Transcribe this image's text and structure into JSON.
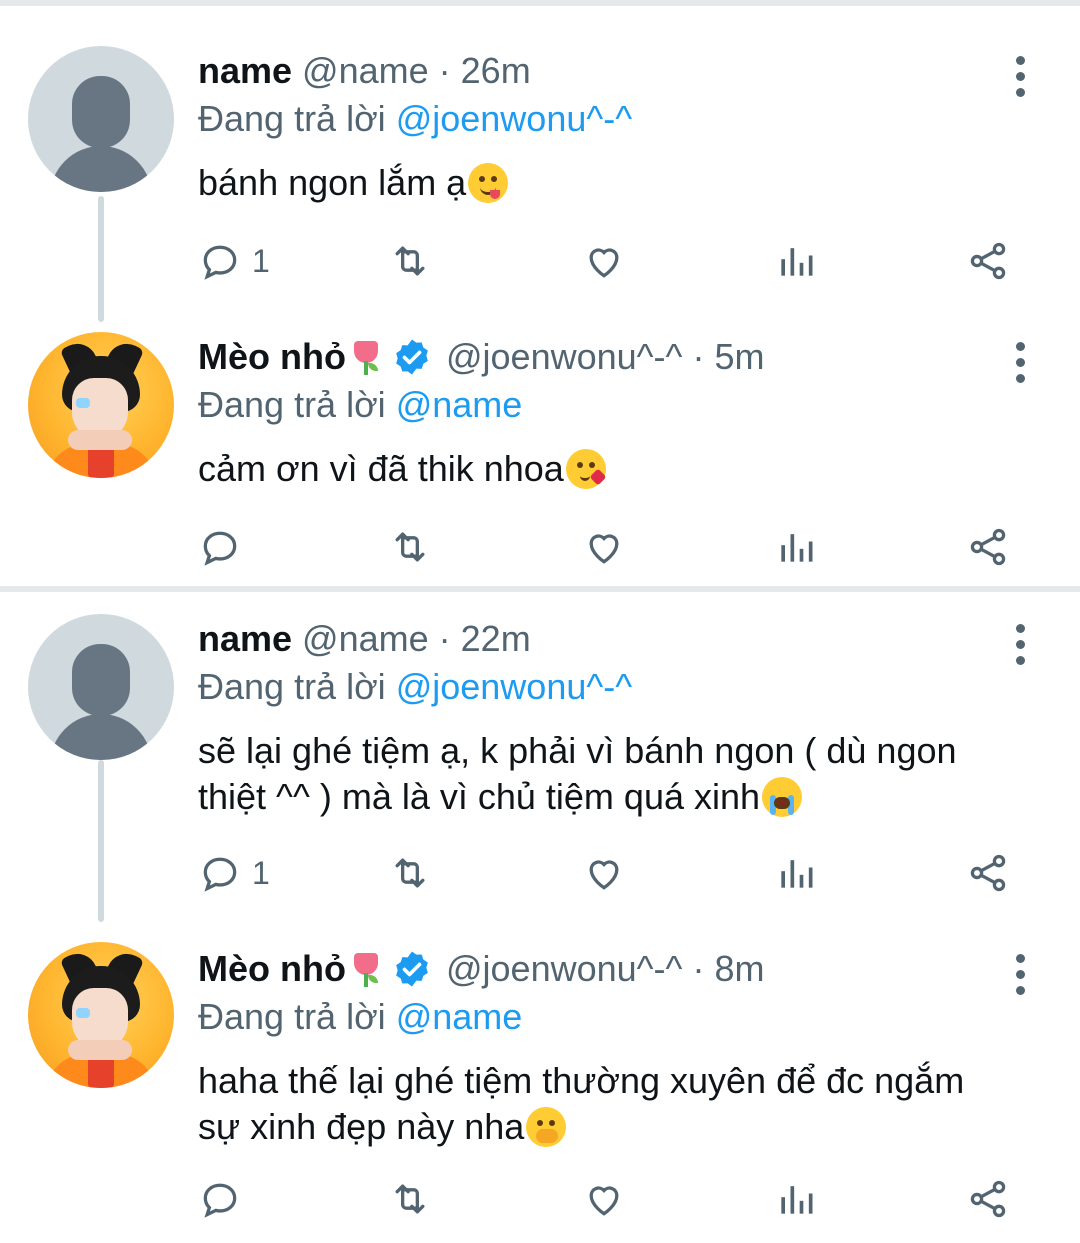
{
  "threads": [
    {
      "tweets": [
        {
          "name": "name",
          "handle": "@name",
          "separator": "·",
          "time": "26m",
          "reply_prefix": "Đang trả lời",
          "reply_to": "@joenwonu^-^",
          "text": "bánh ngon lắm ạ",
          "emoji": "face-savoring-food-emoji",
          "reply_count": "1"
        },
        {
          "name": "Mèo nhỏ",
          "handle": "@joenwonu^-^",
          "separator": "·",
          "time": "5m",
          "reply_prefix": "Đang trả lời",
          "reply_to": "@name",
          "text": "cảm ơn vì đã thik nhoa",
          "emoji": "face-blowing-kiss-emoji",
          "reply_count": ""
        }
      ]
    },
    {
      "tweets": [
        {
          "name": "name",
          "handle": "@name",
          "separator": "·",
          "time": "22m",
          "reply_prefix": "Đang trả lời",
          "reply_to": "@joenwonu^-^",
          "text_line1": "sẽ lại ghé tiệm ạ, k phải vì bánh ngon ( dù ngon",
          "text_line2": "thiệt ^^ ) mà là vì chủ tiệm quá xinh",
          "emoji": "loudly-crying-face-emoji",
          "reply_count": "1"
        },
        {
          "name": "Mèo nhỏ",
          "handle": "@joenwonu^-^",
          "separator": "·",
          "time": "8m",
          "reply_prefix": "Đang trả lời",
          "reply_to": "@name",
          "text_line1": "haha thế lại ghé tiệm thường xuyên để đc ngắm",
          "text_line2": "sự xinh đẹp này nha",
          "emoji": "face-with-hand-over-mouth-emoji",
          "reply_count": ""
        }
      ]
    }
  ],
  "colors": {
    "text": "#0f1419",
    "secondary": "#536471",
    "link": "#1d9bf0",
    "divider": "#e6e9ea",
    "thread_line": "#cfd9de"
  },
  "icons": [
    "reply-icon",
    "retweet-icon",
    "like-icon",
    "analytics-icon",
    "share-icon",
    "more-icon",
    "verified-badge-icon",
    "tulip-emoji"
  ]
}
